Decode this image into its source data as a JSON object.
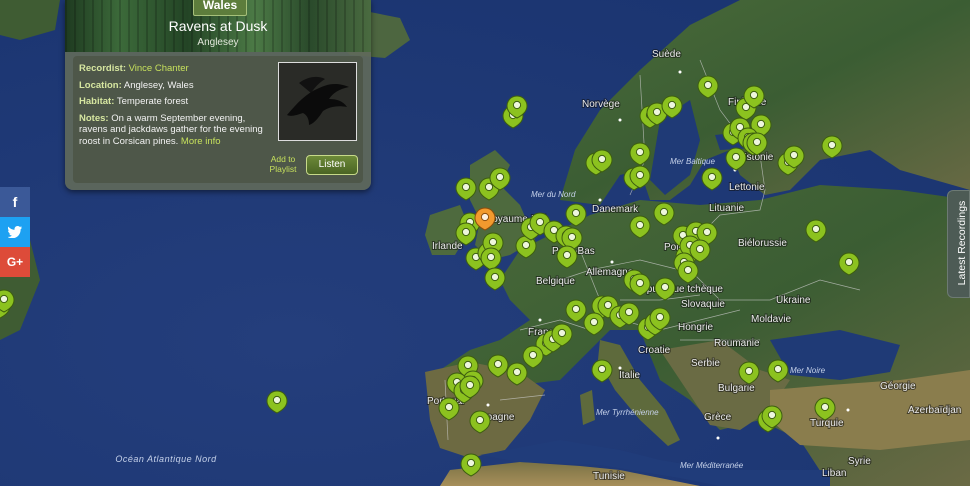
{
  "card": {
    "region": "Wales",
    "title": "Ravens at Dusk",
    "location_line": "Anglesey",
    "recordist_label": "Recordist:",
    "recordist": "Vince Chanter",
    "location_label": "Location:",
    "location": "Anglesey, Wales",
    "habitat_label": "Habitat:",
    "habitat": "Temperate forest",
    "notes_label": "Notes:",
    "notes": "On a warm September evening, ravens and jackdaws gather for the evening roost in Corsican pines.",
    "more": "More info",
    "add_to_playlist": "Add to Playlist",
    "listen": "Listen"
  },
  "share": {
    "facebook": "f",
    "twitter": "t",
    "google": "G+"
  },
  "latest_tab": "Latest Recordings",
  "map_labels": {
    "countries": [
      "Suède",
      "Norvège",
      "Finlande",
      "Estonie",
      "Lettonie",
      "Lituanie",
      "Danemark",
      "Royaume-Uni",
      "Irlande",
      "Pays-Bas",
      "Belgique",
      "Allemagne",
      "Pologne",
      "Biélorussie",
      "Ukraine",
      "République tchèque",
      "Slovaquie",
      "Moldavie",
      "Roumanie",
      "Hongrie",
      "Croatie",
      "Serbie",
      "Bulgarie",
      "Grèce",
      "France",
      "Italie",
      "Espagne",
      "Portugal",
      "Tunisie",
      "Turquie",
      "Géorgie",
      "Azerbaïdjan",
      "Syrie",
      "Liban"
    ],
    "seas": [
      "Mer du Nord",
      "Mer Baltique",
      "Mer Tyrrhénienne",
      "Mer Noire",
      "Mer Méditerranée",
      "Océan Atlantique Nord"
    ]
  },
  "marker_colors": {
    "default": "#8cc21f",
    "selected": "#f29a2e"
  }
}
